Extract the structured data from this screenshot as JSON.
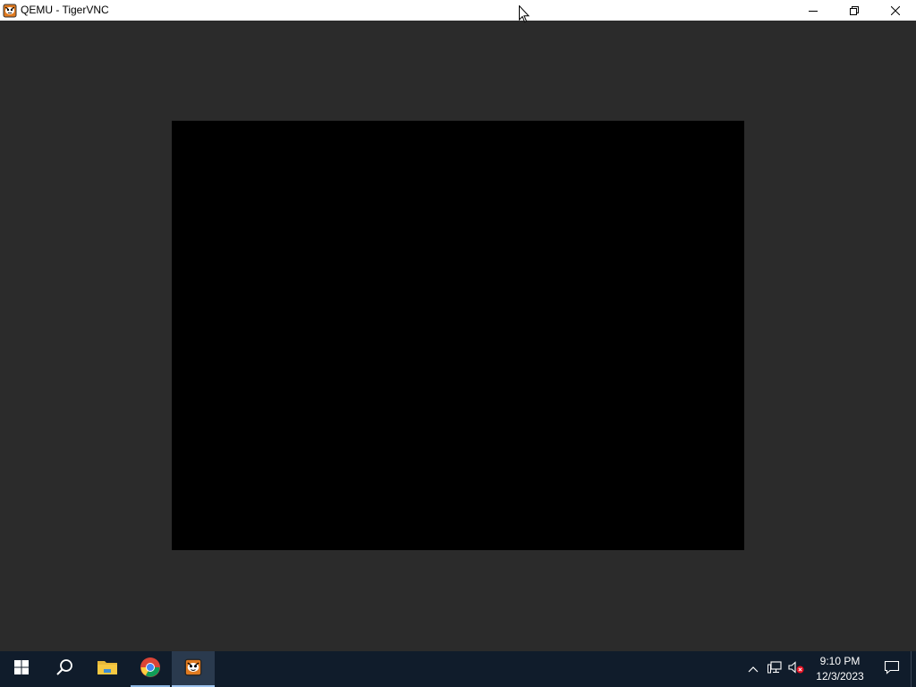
{
  "window": {
    "title": "QEMU - TigerVNC",
    "icon": "tigervnc-icon",
    "controls": [
      "minimize-icon",
      "restore-icon",
      "close-icon"
    ]
  },
  "remote_screen": {
    "color": "#000000"
  },
  "taskbar": {
    "pinned": [
      {
        "name": "start-button",
        "icon": "windows-logo-icon"
      },
      {
        "name": "search-button",
        "icon": "search-icon"
      },
      {
        "name": "file-explorer-button",
        "icon": "folder-icon"
      },
      {
        "name": "chrome-button",
        "icon": "chrome-icon"
      },
      {
        "name": "tigervnc-button",
        "icon": "tigervnc-icon"
      }
    ],
    "tray_icons": [
      "chevron-up-icon",
      "network-icon",
      "volume-muted-icon"
    ],
    "clock": {
      "time": "9:10 PM",
      "date": "12/3/2023"
    },
    "notification_icon": "action-center-icon"
  },
  "colors": {
    "background": "#2b2b2b",
    "taskbar": "#101c2b",
    "titlebar": "#ffffff"
  }
}
